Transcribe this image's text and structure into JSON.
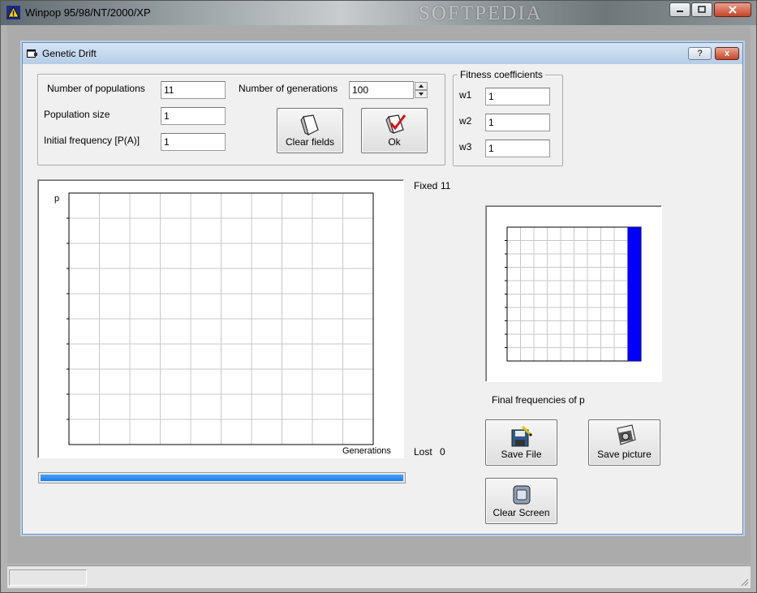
{
  "outer": {
    "title": "Winpop 95/98/NT/2000/XP",
    "watermark": "SOFTPEDIA",
    "controls": {
      "minimize": "",
      "maximize": "",
      "close": ""
    }
  },
  "dialog": {
    "title": "Genetic Drift",
    "help_label": "?",
    "close_label": "x"
  },
  "params": {
    "populations_label": "Number of populations",
    "populations_value": "11",
    "pop_size_label": "Population size",
    "pop_size_value": "1",
    "init_freq_label": "Initial frequency [P(A)]",
    "init_freq_value": "1",
    "generations_label": "Number of generations",
    "generations_value": "100",
    "clear_label": "Clear fields",
    "ok_label": "Ok"
  },
  "fitness": {
    "legend": "Fitness coefficients",
    "w1_label": "w1",
    "w1_value": "1",
    "w2_label": "w2",
    "w2_value": "1",
    "w3_label": "w3",
    "w3_value": "1"
  },
  "stats": {
    "fixed_label": "Fixed",
    "fixed_value": "11",
    "lost_label": "Lost",
    "lost_value": "0"
  },
  "drift_chart": {
    "y_label": "p",
    "x_label": "Generations",
    "grid": true
  },
  "freq_chart": {
    "caption": "Final frequencies of p",
    "bins": 10,
    "counts": [
      0,
      0,
      0,
      0,
      0,
      0,
      0,
      0,
      0,
      11
    ],
    "bar_color": "#0000ff"
  },
  "actions": {
    "save_file": "Save File",
    "save_picture": "Save picture",
    "clear_screen": "Clear Screen"
  },
  "progress": {
    "fraction": 1.0,
    "color": "#2f8cf5"
  },
  "colors": {
    "accent": "#0000ff",
    "grid": "#c8c8c8"
  }
}
